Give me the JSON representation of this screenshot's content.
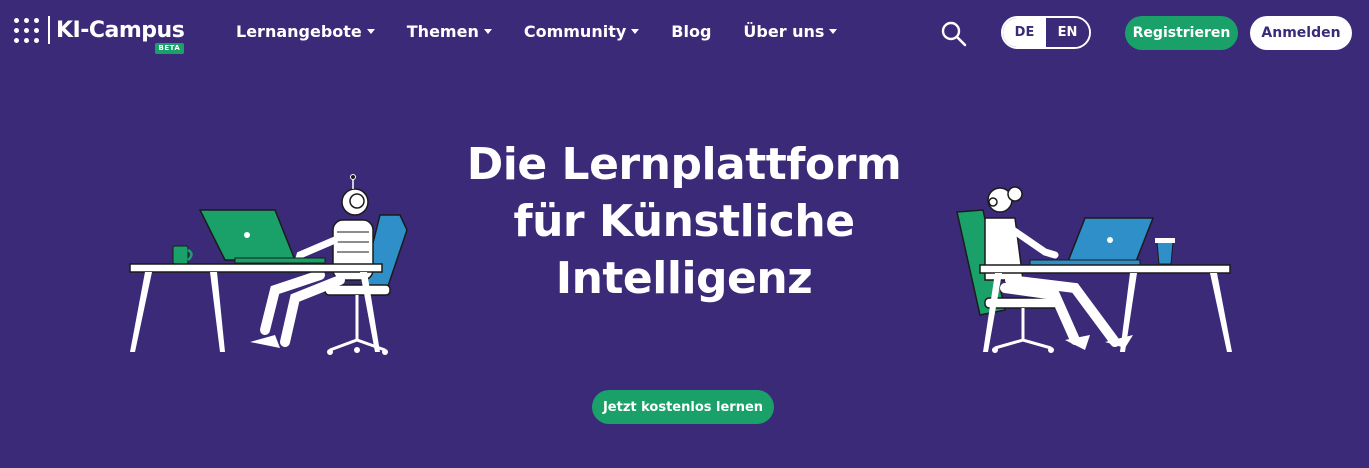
{
  "header": {
    "logo_text": "KI-Campus",
    "beta_label": "BETA",
    "nav": [
      {
        "label": "Lernangebote",
        "dropdown": true
      },
      {
        "label": "Themen",
        "dropdown": true
      },
      {
        "label": "Community",
        "dropdown": true
      },
      {
        "label": "Blog",
        "dropdown": false
      },
      {
        "label": "Über uns",
        "dropdown": true
      }
    ],
    "search_icon": "search-icon",
    "languages": {
      "de": "DE",
      "en": "EN",
      "active": "DE"
    },
    "register_label": "Registrieren",
    "login_label": "Anmelden"
  },
  "hero": {
    "title_line1": "Die Lernplattform",
    "title_line2": "für Künstliche",
    "title_line3": "Intelligenz",
    "cta_label": "Jetzt kostenlos lernen"
  },
  "colors": {
    "background": "#3b2a78",
    "accent_green": "#1aa16a",
    "laptop_blue": "#2f8fc9",
    "text": "#ffffff"
  }
}
